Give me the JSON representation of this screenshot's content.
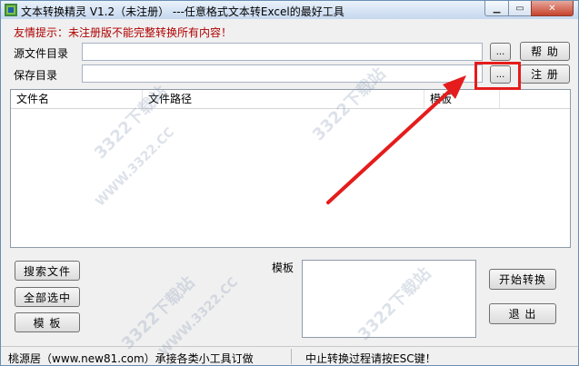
{
  "window": {
    "title": "文本转换精灵 V1.2（未注册）  ---任意格式文本转Excel的最好工具",
    "min_glyph": "▁",
    "max_glyph": "▭",
    "close_glyph": "✕"
  },
  "hint": "友情提示：未注册版不能完整转换所有内容！",
  "source": {
    "label": "源文件目录",
    "value": "",
    "browse_label": "...",
    "help_label": "帮 助"
  },
  "save": {
    "label": "保存目录",
    "value": "",
    "browse_label": "...",
    "register_label": "注 册"
  },
  "table": {
    "columns": [
      "文件名",
      "文件路径",
      "模板",
      ""
    ],
    "rows": []
  },
  "buttons": {
    "search": "搜索文件",
    "select_all": "全部选中",
    "template": "模 板",
    "start": "开始转换",
    "exit": "退 出"
  },
  "template_label": "模板",
  "template_value": "",
  "status": {
    "left": "桃源居（www.new81.com）承接各类小工具订做",
    "right": "中止转换过程请按ESC键！"
  },
  "watermark": "3322下载站",
  "watermark2": "WWW.3322.CC",
  "annotation": {
    "color": "#e51c1c"
  }
}
